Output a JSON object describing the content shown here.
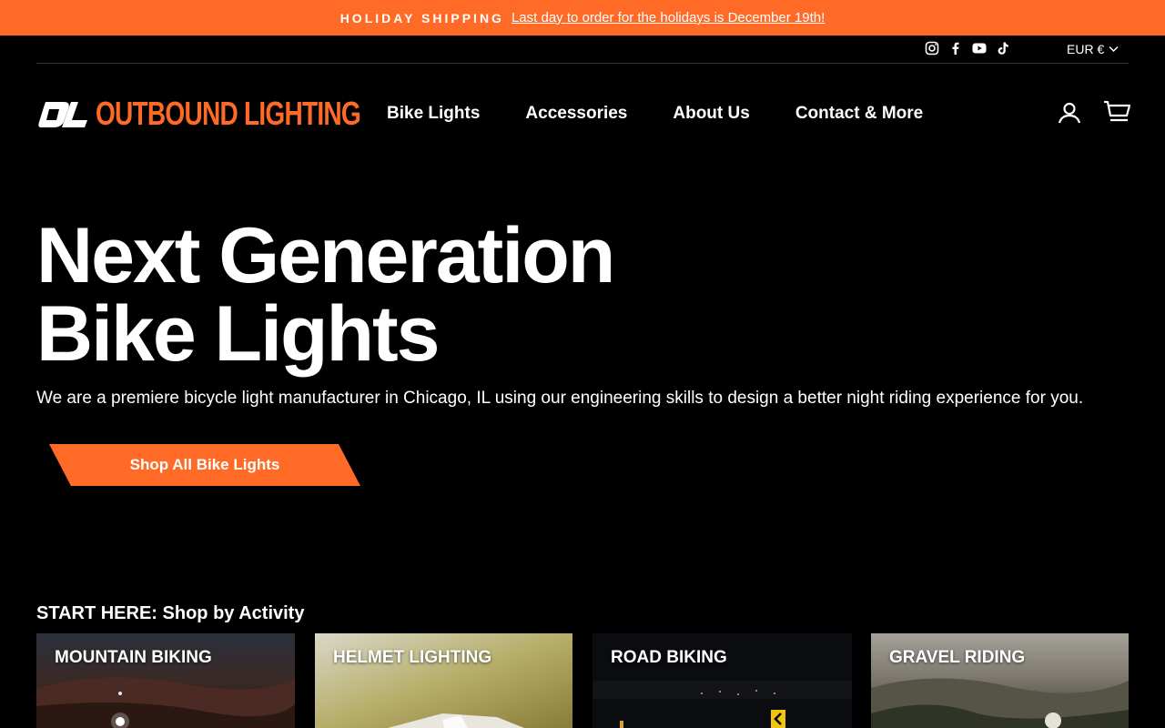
{
  "announcement": {
    "label": "HOLIDAY SHIPPING",
    "link_text": "Last day to order for the holidays is December 19th!"
  },
  "utility": {
    "social_icons": [
      "instagram-icon",
      "facebook-icon",
      "youtube-icon",
      "tiktok-icon"
    ],
    "currency": "EUR €"
  },
  "brand": {
    "name": "OUTBOUND LIGHTING",
    "accent_color": "#ff6b26"
  },
  "nav": {
    "items": [
      "Bike Lights",
      "Accessories",
      "About Us",
      "Contact & More"
    ]
  },
  "header_icons": [
    "account-icon",
    "cart-icon"
  ],
  "hero": {
    "title_line1": "Next Generation",
    "title_line2": "Bike Lights",
    "description": "We are a premiere bicycle light manufacturer in Chicago, IL using our engineering skills to design a better night riding experience for you.",
    "cta_label": "Shop All Bike Lights"
  },
  "activities": {
    "heading": "START HERE: Shop by Activity",
    "cards": [
      {
        "title": "MOUNTAIN BIKING"
      },
      {
        "title": "HELMET LIGHTING"
      },
      {
        "title": "ROAD BIKING"
      },
      {
        "title": "GRAVEL RIDING"
      }
    ]
  }
}
